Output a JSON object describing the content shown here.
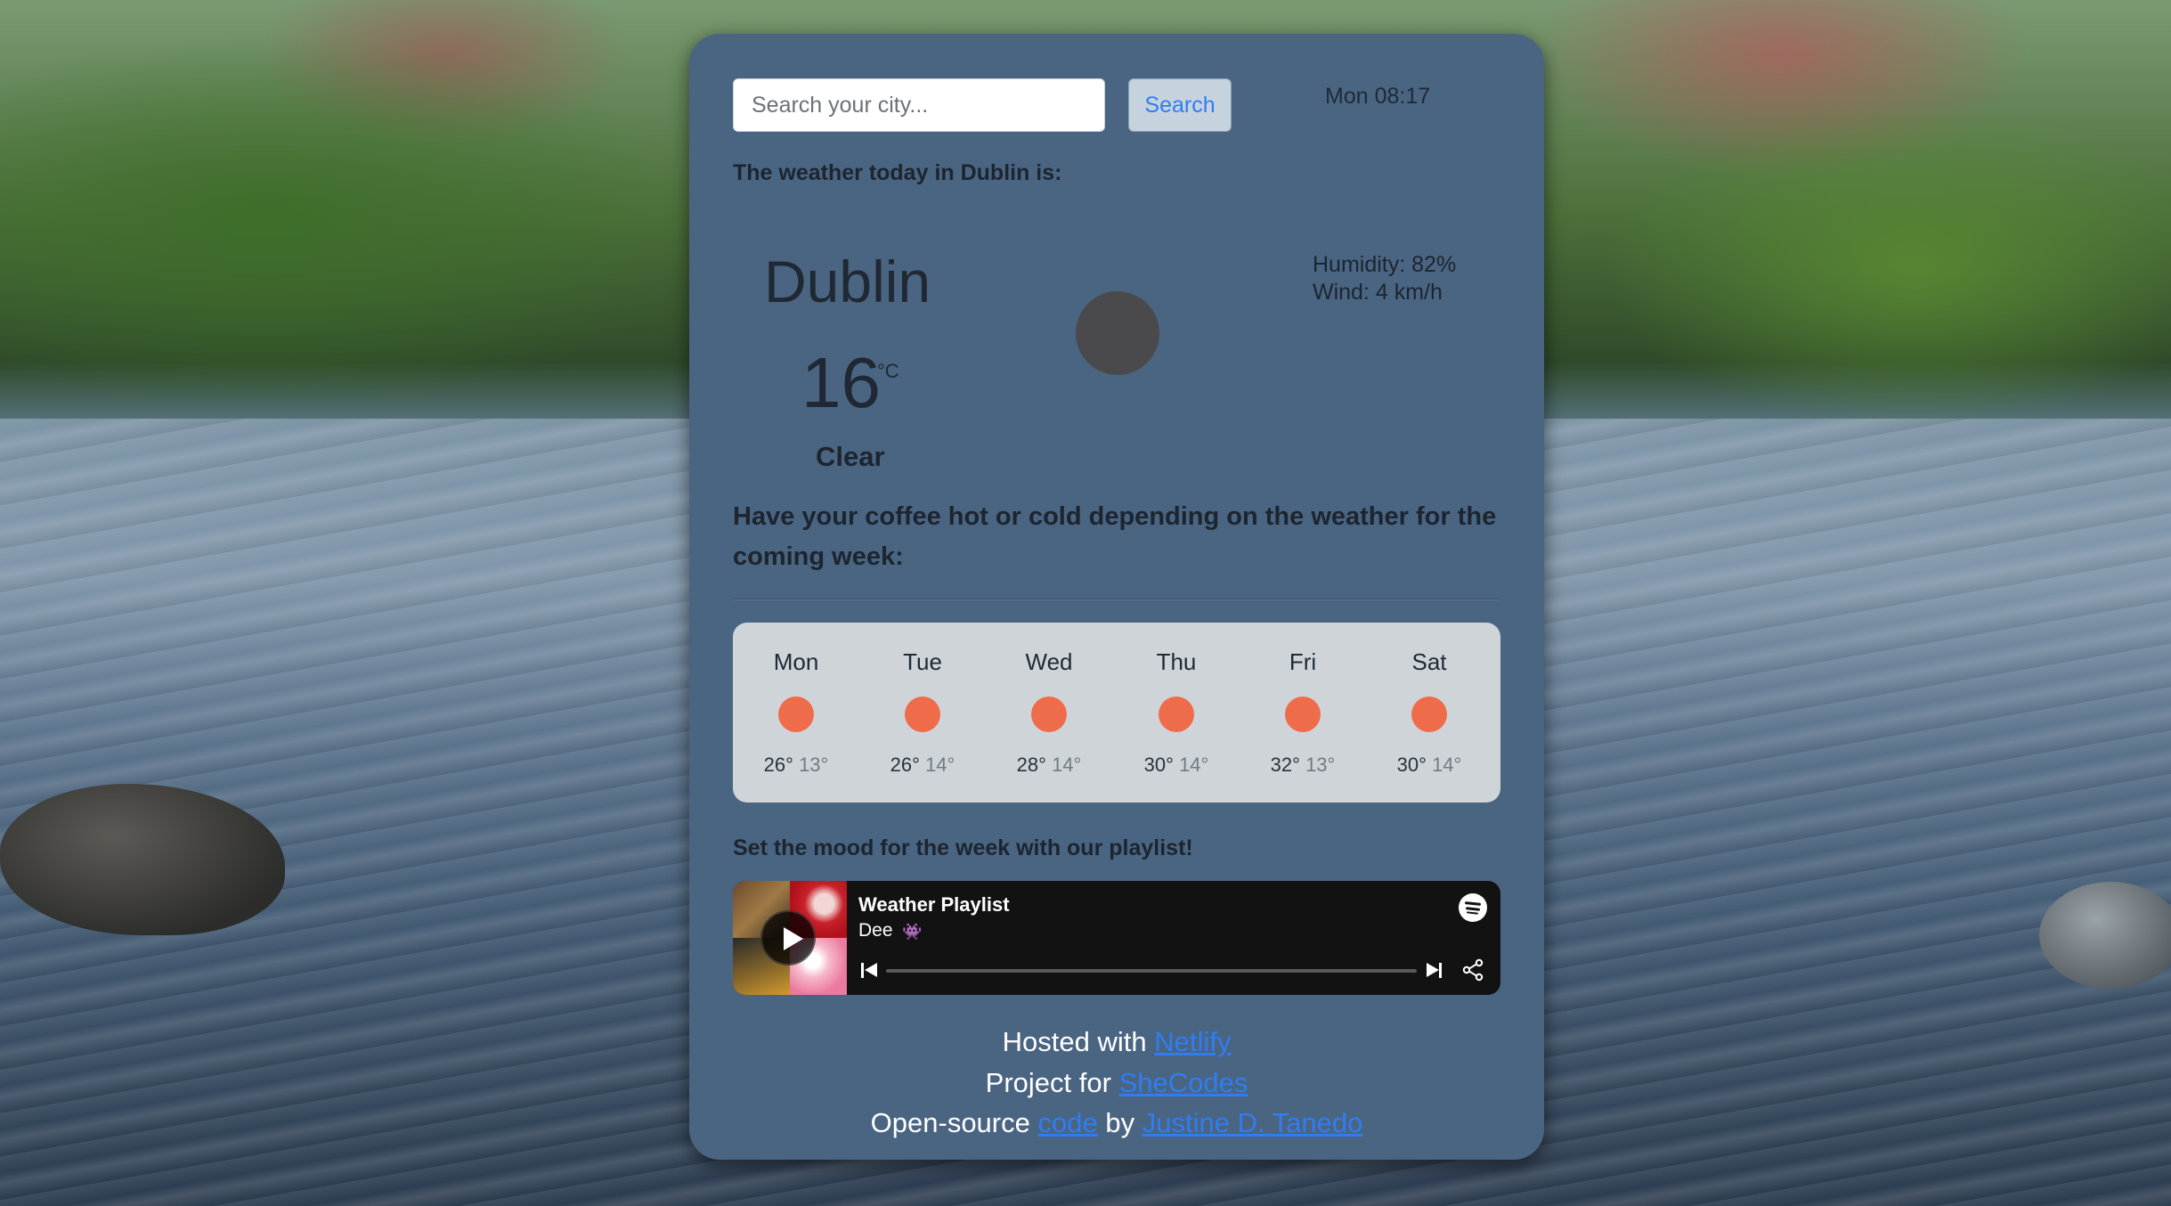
{
  "search": {
    "placeholder": "Search your city...",
    "value": "",
    "button_label": "Search"
  },
  "datetime": "Mon 08:17",
  "current": {
    "heading": "The weather today in Dublin is:",
    "city": "Dublin",
    "temperature": "16",
    "unit": "°C",
    "condition": "Clear",
    "icon": "moon-dark-circle-icon",
    "humidity_text": "Humidity: 82%",
    "wind_text": "Wind: 4 km/h"
  },
  "coffee_heading": "Have your coffee hot or cold depending on the weather for the coming week:",
  "forecast": [
    {
      "day": "Mon",
      "max": "26°",
      "min": "13°",
      "icon": "sun-icon"
    },
    {
      "day": "Tue",
      "max": "26°",
      "min": "14°",
      "icon": "sun-icon"
    },
    {
      "day": "Wed",
      "max": "28°",
      "min": "14°",
      "icon": "sun-icon"
    },
    {
      "day": "Thu",
      "max": "30°",
      "min": "14°",
      "icon": "sun-icon"
    },
    {
      "day": "Fri",
      "max": "32°",
      "min": "13°",
      "icon": "sun-icon"
    },
    {
      "day": "Sat",
      "max": "30°",
      "min": "14°",
      "icon": "sun-icon"
    }
  ],
  "playlist": {
    "heading": "Set the mood for the week with our playlist!",
    "title": "Weather Playlist",
    "artist": "Dee",
    "artist_emoji": "👾",
    "progress_fraction": 0.0
  },
  "footer": {
    "line1_prefix": "Hosted with",
    "line1_link": "Netlify",
    "line2_prefix": "Project for",
    "line2_link": "SheCodes",
    "line3_prefix": "Open-source",
    "line3_link1": "code",
    "line3_mid": "by",
    "line3_link2": "Justine D. Tanedo"
  },
  "colors": {
    "card_bg": "#4a6582",
    "forecast_bg": "#cfd4d9",
    "sun_icon": "#ef6c4a",
    "link": "#2f7df3",
    "player_bg": "#121212"
  }
}
